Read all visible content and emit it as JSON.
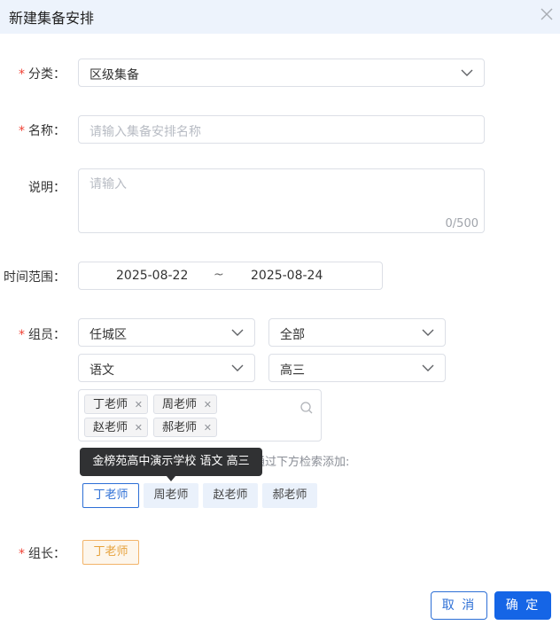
{
  "dialog": {
    "title": "新建集备安排"
  },
  "form": {
    "category": {
      "label": "分类：",
      "value": "区级集备"
    },
    "name": {
      "label": "名称：",
      "placeholder": "请输入集备安排名称"
    },
    "description": {
      "label": "说明：",
      "placeholder": "请输入",
      "counter": "0/500"
    },
    "time_range": {
      "label": "时间范围：",
      "start": "2025-08-22",
      "separator": "~",
      "end": "2025-08-24"
    },
    "members": {
      "label": "组员：",
      "filter_district": "任城区",
      "filter_school": "全部",
      "filter_subject": "语文",
      "filter_grade": "高三",
      "selected_tags": [
        "丁老师",
        "周老师",
        "赵老师",
        "郝老师"
      ],
      "hint": "通过下方检索添加:",
      "tooltip": "金榜苑高中演示学校 语文 高三",
      "candidates": [
        "丁老师",
        "周老师",
        "赵老师",
        "郝老师"
      ]
    },
    "leader": {
      "label": "组长：",
      "value": "丁老师"
    }
  },
  "footer": {
    "cancel_label": "取 消",
    "confirm_label": "确 定"
  },
  "colors": {
    "primary": "#1565e6",
    "required": "#f04134",
    "leader": "#e6a23c",
    "header_bg": "#edf3fc"
  }
}
